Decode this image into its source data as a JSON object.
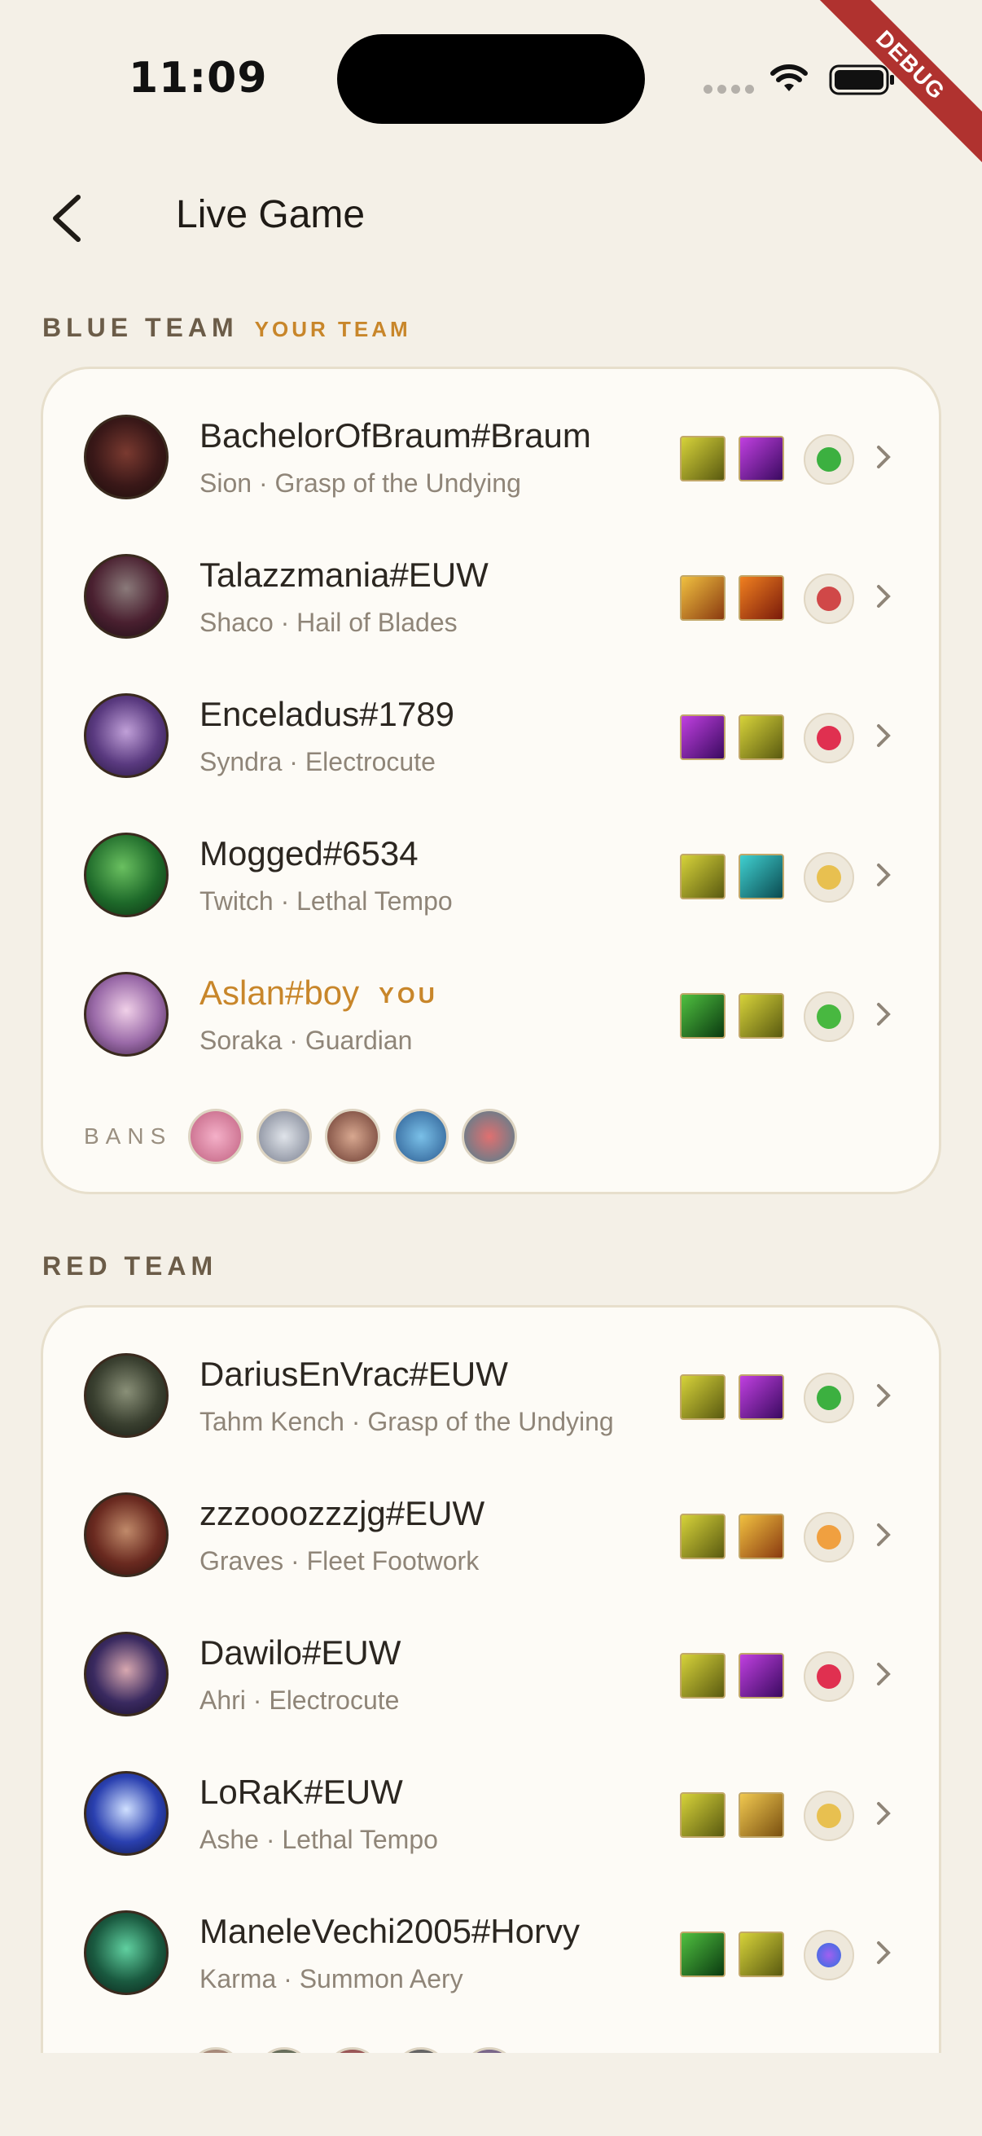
{
  "status": {
    "time": "11:09",
    "debug": "DEBUG"
  },
  "header": {
    "title": "Live Game"
  },
  "blue_team": {
    "label": "BLUE TEAM",
    "tag": "YOUR TEAM",
    "players": [
      {
        "name": "BachelorOfBraum#Braum",
        "champion": "Sion",
        "rune": "Grasp of the Undying"
      },
      {
        "name": "Talazzmania#EUW",
        "champion": "Shaco",
        "rune": "Hail of Blades"
      },
      {
        "name": "Enceladus#1789",
        "champion": "Syndra",
        "rune": "Electrocute"
      },
      {
        "name": "Mogged#6534",
        "champion": "Twitch",
        "rune": "Lethal Tempo"
      },
      {
        "name": "Aslan#boy",
        "champion": "Soraka",
        "rune": "Guardian",
        "you": "YOU"
      }
    ],
    "bans_label": "BANS"
  },
  "red_team": {
    "label": "RED TEAM",
    "players": [
      {
        "name": "DariusEnVrac#EUW",
        "champion": "Tahm Kench",
        "rune": "Grasp of the Undying"
      },
      {
        "name": "zzzooozzzjg#EUW",
        "champion": "Graves",
        "rune": "Fleet Footwork"
      },
      {
        "name": "Dawilo#EUW",
        "champion": "Ahri",
        "rune": "Electrocute"
      },
      {
        "name": "LoRaK#EUW",
        "champion": "Ashe",
        "rune": "Lethal Tempo"
      },
      {
        "name": "ManeleVechi2005#Horvy",
        "champion": "Karma",
        "rune": "Summon Aery"
      }
    ]
  },
  "separator": " · ",
  "colors": {
    "background": "#f4f0e7",
    "accent": "#c8862a",
    "card": "#fdfbf6"
  }
}
